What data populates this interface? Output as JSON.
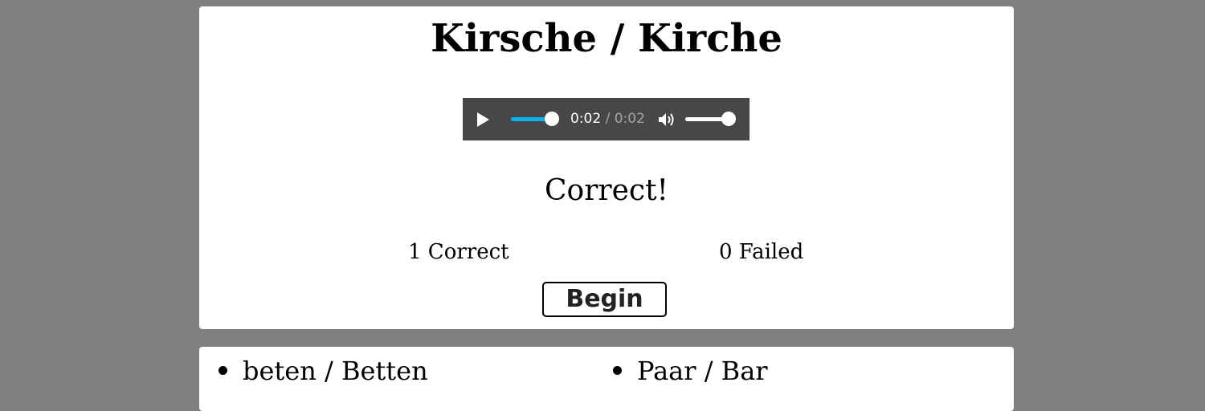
{
  "quiz": {
    "title": "Kirsche / Kirche",
    "result": "Correct!",
    "score": {
      "correct": "1 Correct",
      "failed": "0 Failed"
    },
    "begin_label": "Begin"
  },
  "audio_player": {
    "current_time": "0:02",
    "separator": " / ",
    "duration": "0:02",
    "progress": 1.0,
    "volume": 1.0,
    "play_icon": "play-icon",
    "volume_icon": "speaker-icon",
    "colors": {
      "background": "#474747",
      "progress": "#0ab0ef"
    }
  },
  "pairs": [
    {
      "label": "beten / Betten"
    },
    {
      "label": "Paar / Bar"
    }
  ],
  "colors": {
    "page_background": "#808080",
    "card": "#ffffff"
  }
}
